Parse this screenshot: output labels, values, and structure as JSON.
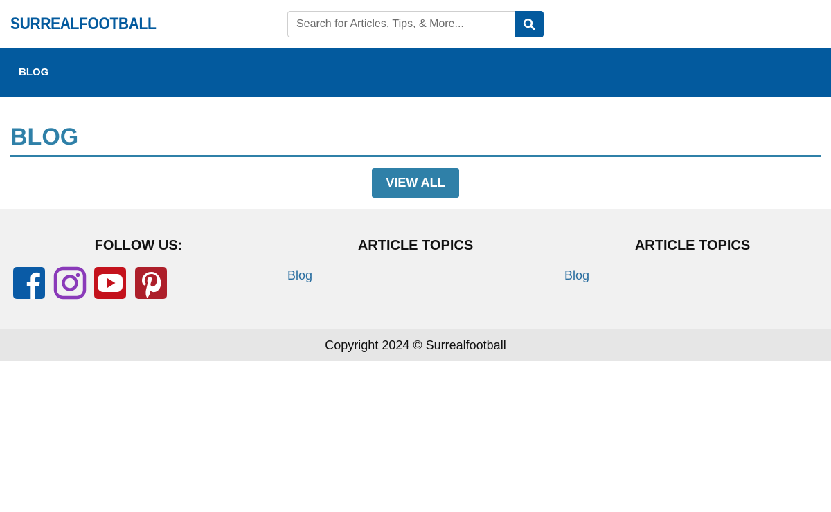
{
  "header": {
    "logo_text": "SURREALFOOTBALL",
    "search": {
      "placeholder": "Search for Articles, Tips, & More...",
      "value": "",
      "button_icon": "search-icon"
    }
  },
  "nav": {
    "items": [
      {
        "label": "BLOG"
      }
    ]
  },
  "main": {
    "title": "BLOG",
    "view_all_label": "VIEW ALL"
  },
  "footer": {
    "follow": {
      "heading": "FOLLOW US:",
      "icons": [
        "facebook-icon",
        "instagram-icon",
        "youtube-icon",
        "pinterest-icon"
      ]
    },
    "topics": [
      {
        "heading": "ARTICLE TOPICS",
        "links": [
          "Blog"
        ]
      },
      {
        "heading": "ARTICLE TOPICS",
        "links": [
          "Blog"
        ]
      }
    ],
    "copyright": "Copyright 2024 © Surrealfootball"
  },
  "colors": {
    "brand_blue": "#035a9e",
    "title_blue": "#2f80a8",
    "link_blue": "#2a6ea0",
    "footer_bg": "#f1f1f1",
    "copyright_bg": "#e6e6e6",
    "facebook": "#0a5ba6",
    "instagram": "#8a3ab9",
    "youtube": "#c4121c",
    "pinterest": "#ad1f2a"
  }
}
